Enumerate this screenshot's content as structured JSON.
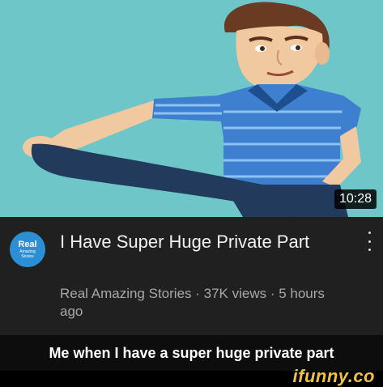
{
  "video": {
    "duration": "10:28",
    "title": "I Have Super Huge Private Part",
    "channel_name": "Real Amazing Stories",
    "views": "37K views",
    "age": "5 hours ago",
    "meta_line": "Real Amazing Stories · 37K views · 5 hours ago"
  },
  "channel_avatar": {
    "line1": "Real",
    "line2": "Amazing",
    "line3": "Stories"
  },
  "caption": "Me when I have a super huge private part",
  "watermark": "ifunny.co",
  "icons": [
    "more-vert-icon"
  ],
  "colors": {
    "thumbnail_bg": "#6fc6c8",
    "info_bg": "#202020",
    "caption_bg": "#0d0d0d",
    "watermark": "#f4c23a"
  }
}
